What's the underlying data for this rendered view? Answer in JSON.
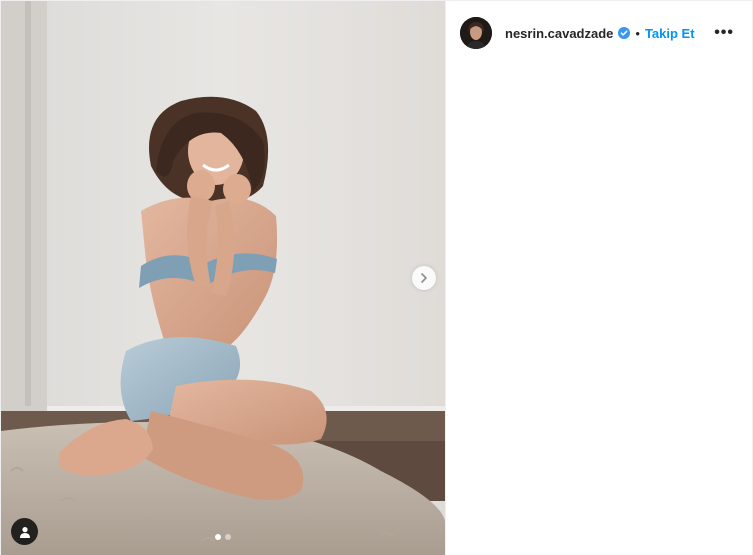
{
  "post": {
    "username": "nesrin.cavadzade",
    "separator": "•",
    "follow_label": "Takip Et",
    "more_label": "•••",
    "carousel": {
      "slide_count": 2,
      "active_index": 0
    }
  },
  "icons": {
    "verified": "verified-badge-icon",
    "next": "chevron-right-icon",
    "user_tag": "user-tag-icon",
    "more": "more-options-icon"
  },
  "colors": {
    "follow": "#0095f6",
    "verified": "#3897f0",
    "text": "#262626"
  }
}
